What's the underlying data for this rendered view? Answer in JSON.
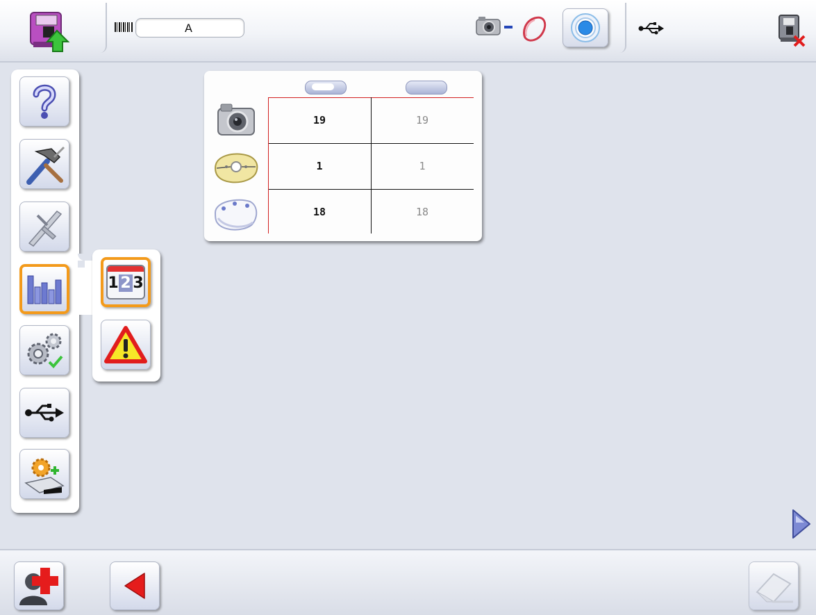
{
  "header": {
    "job_field_value": "A"
  },
  "side_menu": {
    "items": [
      {
        "name": "help",
        "icon": "question-mark-icon"
      },
      {
        "name": "tools",
        "icon": "hammer-screwdriver-icon"
      },
      {
        "name": "measure",
        "icon": "caliper-icon"
      },
      {
        "name": "statistics",
        "icon": "bar-chart-icon",
        "selected": true
      },
      {
        "name": "settings",
        "icon": "gears-icon"
      },
      {
        "name": "usb",
        "icon": "usb-icon"
      },
      {
        "name": "add-settings",
        "icon": "gear-plus-icon"
      }
    ],
    "sub_items": [
      {
        "name": "counters",
        "icon": "counter-123-icon",
        "selected": true,
        "digits": [
          "1",
          "2",
          "3"
        ]
      },
      {
        "name": "warnings",
        "icon": "warning-triangle-icon"
      }
    ]
  },
  "stats_table": {
    "rows": [
      {
        "icon": "camera-icon",
        "col1": "19",
        "col2": "19"
      },
      {
        "icon": "lens-template-icon",
        "col1": "1",
        "col2": "1"
      },
      {
        "icon": "lens-shape-icon",
        "col1": "18",
        "col2": "18"
      }
    ]
  },
  "colors": {
    "selection_orange": "#f39a1b",
    "nav_red": "#e51c1c",
    "table_red_line": "#d21f1f",
    "background": "#dfe3ec"
  }
}
